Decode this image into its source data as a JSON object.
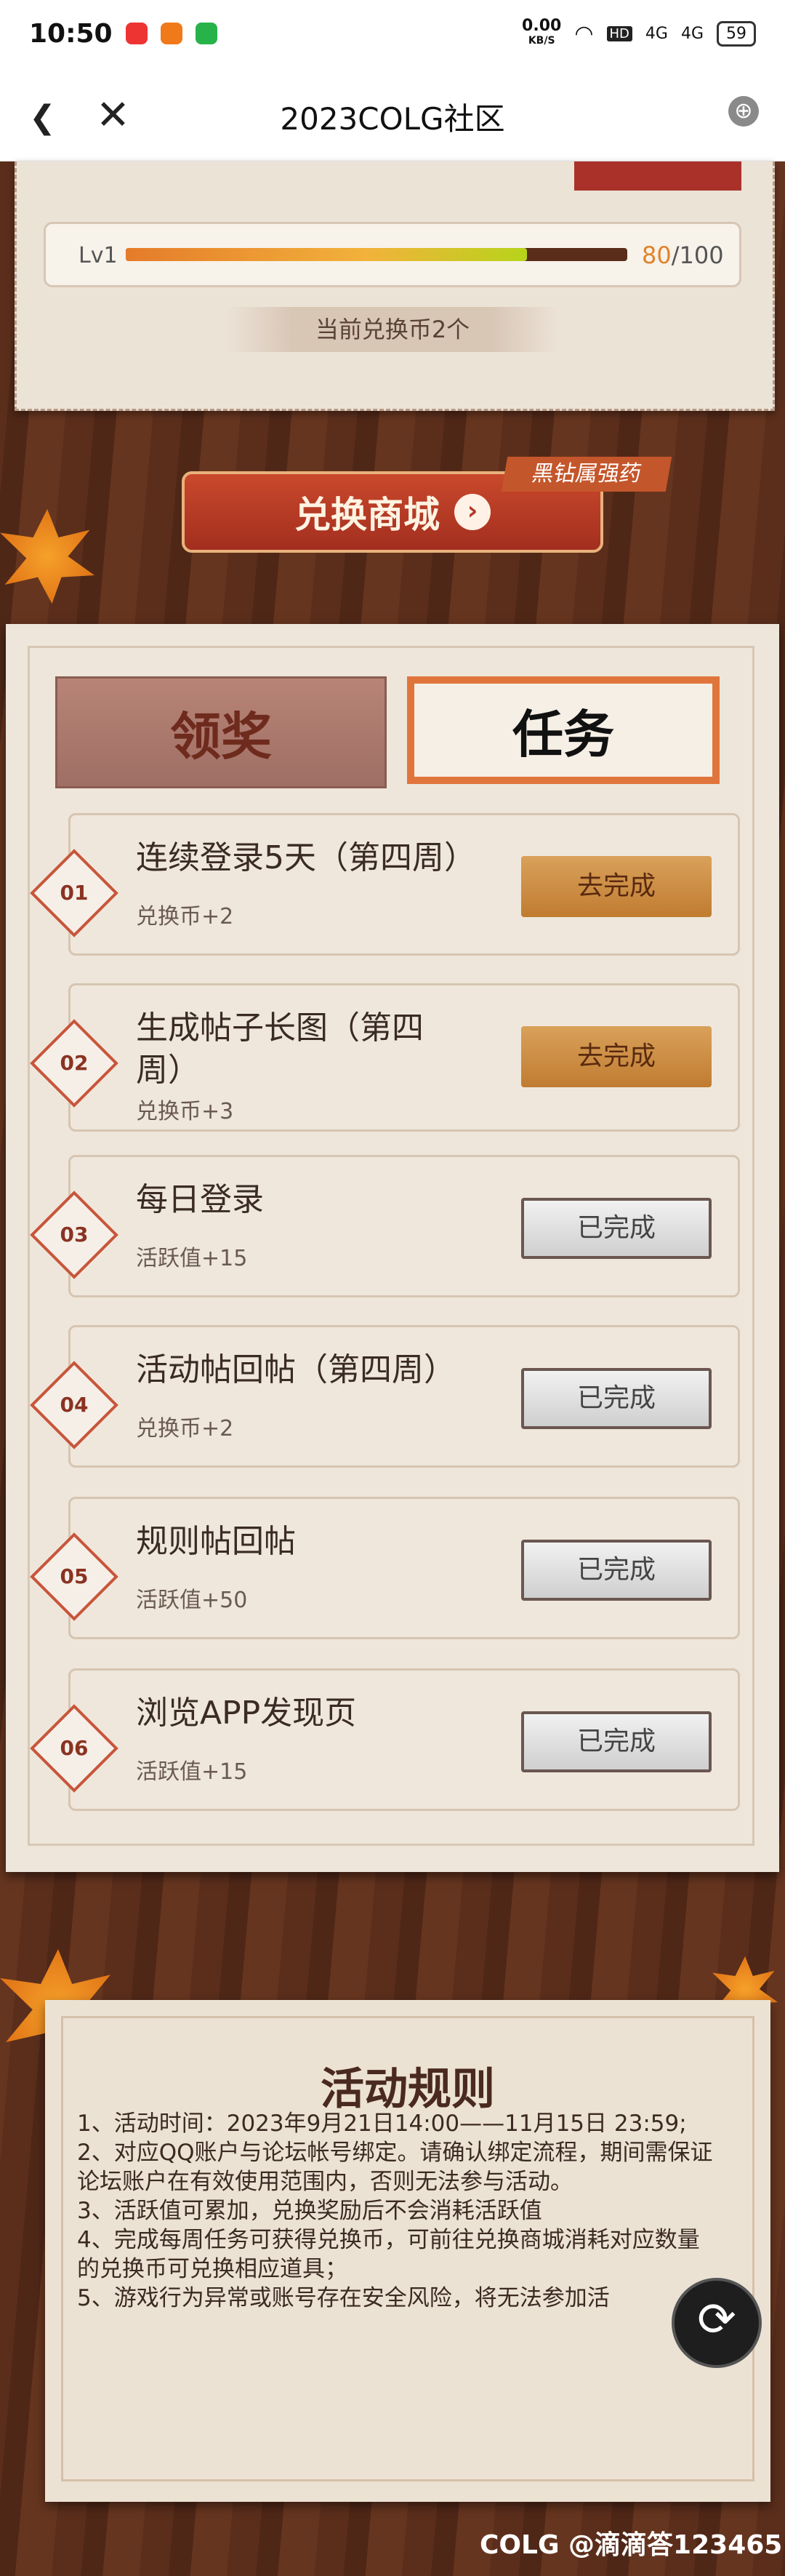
{
  "status": {
    "time": "10:50",
    "speed": "0.00",
    "speed_unit": "KB/S",
    "hd": "HD",
    "signal1": "4G",
    "signal2": "4G",
    "battery": "59"
  },
  "nav": {
    "title": "2023COLG社区"
  },
  "level": {
    "label": "Lv1",
    "current": "80",
    "max": "/100",
    "progress": 0.8
  },
  "coins_text": "当前兑换币2个",
  "shop": {
    "label": "兑换商城",
    "tag": "黑钻属强药"
  },
  "tabs": {
    "reward": "领奖",
    "task": "任务"
  },
  "tasks": [
    {
      "num": "01",
      "name": "连续登录5天（第四周）",
      "reward": "兑换币+2",
      "button": "去完成",
      "done": false
    },
    {
      "num": "02",
      "name": "生成帖子长图（第四周）",
      "reward": "兑换币+3",
      "button": "去完成",
      "done": false
    },
    {
      "num": "03",
      "name": "每日登录",
      "reward": "活跃值+15",
      "button": "已完成",
      "done": true
    },
    {
      "num": "04",
      "name": "活动帖回帖（第四周）",
      "reward": "兑换币+2",
      "button": "已完成",
      "done": true
    },
    {
      "num": "05",
      "name": "规则帖回帖",
      "reward": "活跃值+50",
      "button": "已完成",
      "done": true
    },
    {
      "num": "06",
      "name": "浏览APP发现页",
      "reward": "活跃值+15",
      "button": "已完成",
      "done": true
    }
  ],
  "rules": {
    "title": "活动规则",
    "items": [
      "1、活动时间：2023年9月21日14:00——11月15日 23:59;",
      "2、对应QQ账户与论坛帐号绑定。请确认绑定流程，期间需保证论坛账户在有效使用范围内，否则无法参与活动。",
      "3、活跃值可累加，兑换奖励后不会消耗活跃值",
      "4、完成每周任务可获得兑换币，可前往兑换商城消耗对应数量的兑换币可兑换相应道具；",
      "5、游戏行为异常或账号存在安全风险，将无法参加活"
    ]
  },
  "watermark": "COLG @滴滴答123465"
}
